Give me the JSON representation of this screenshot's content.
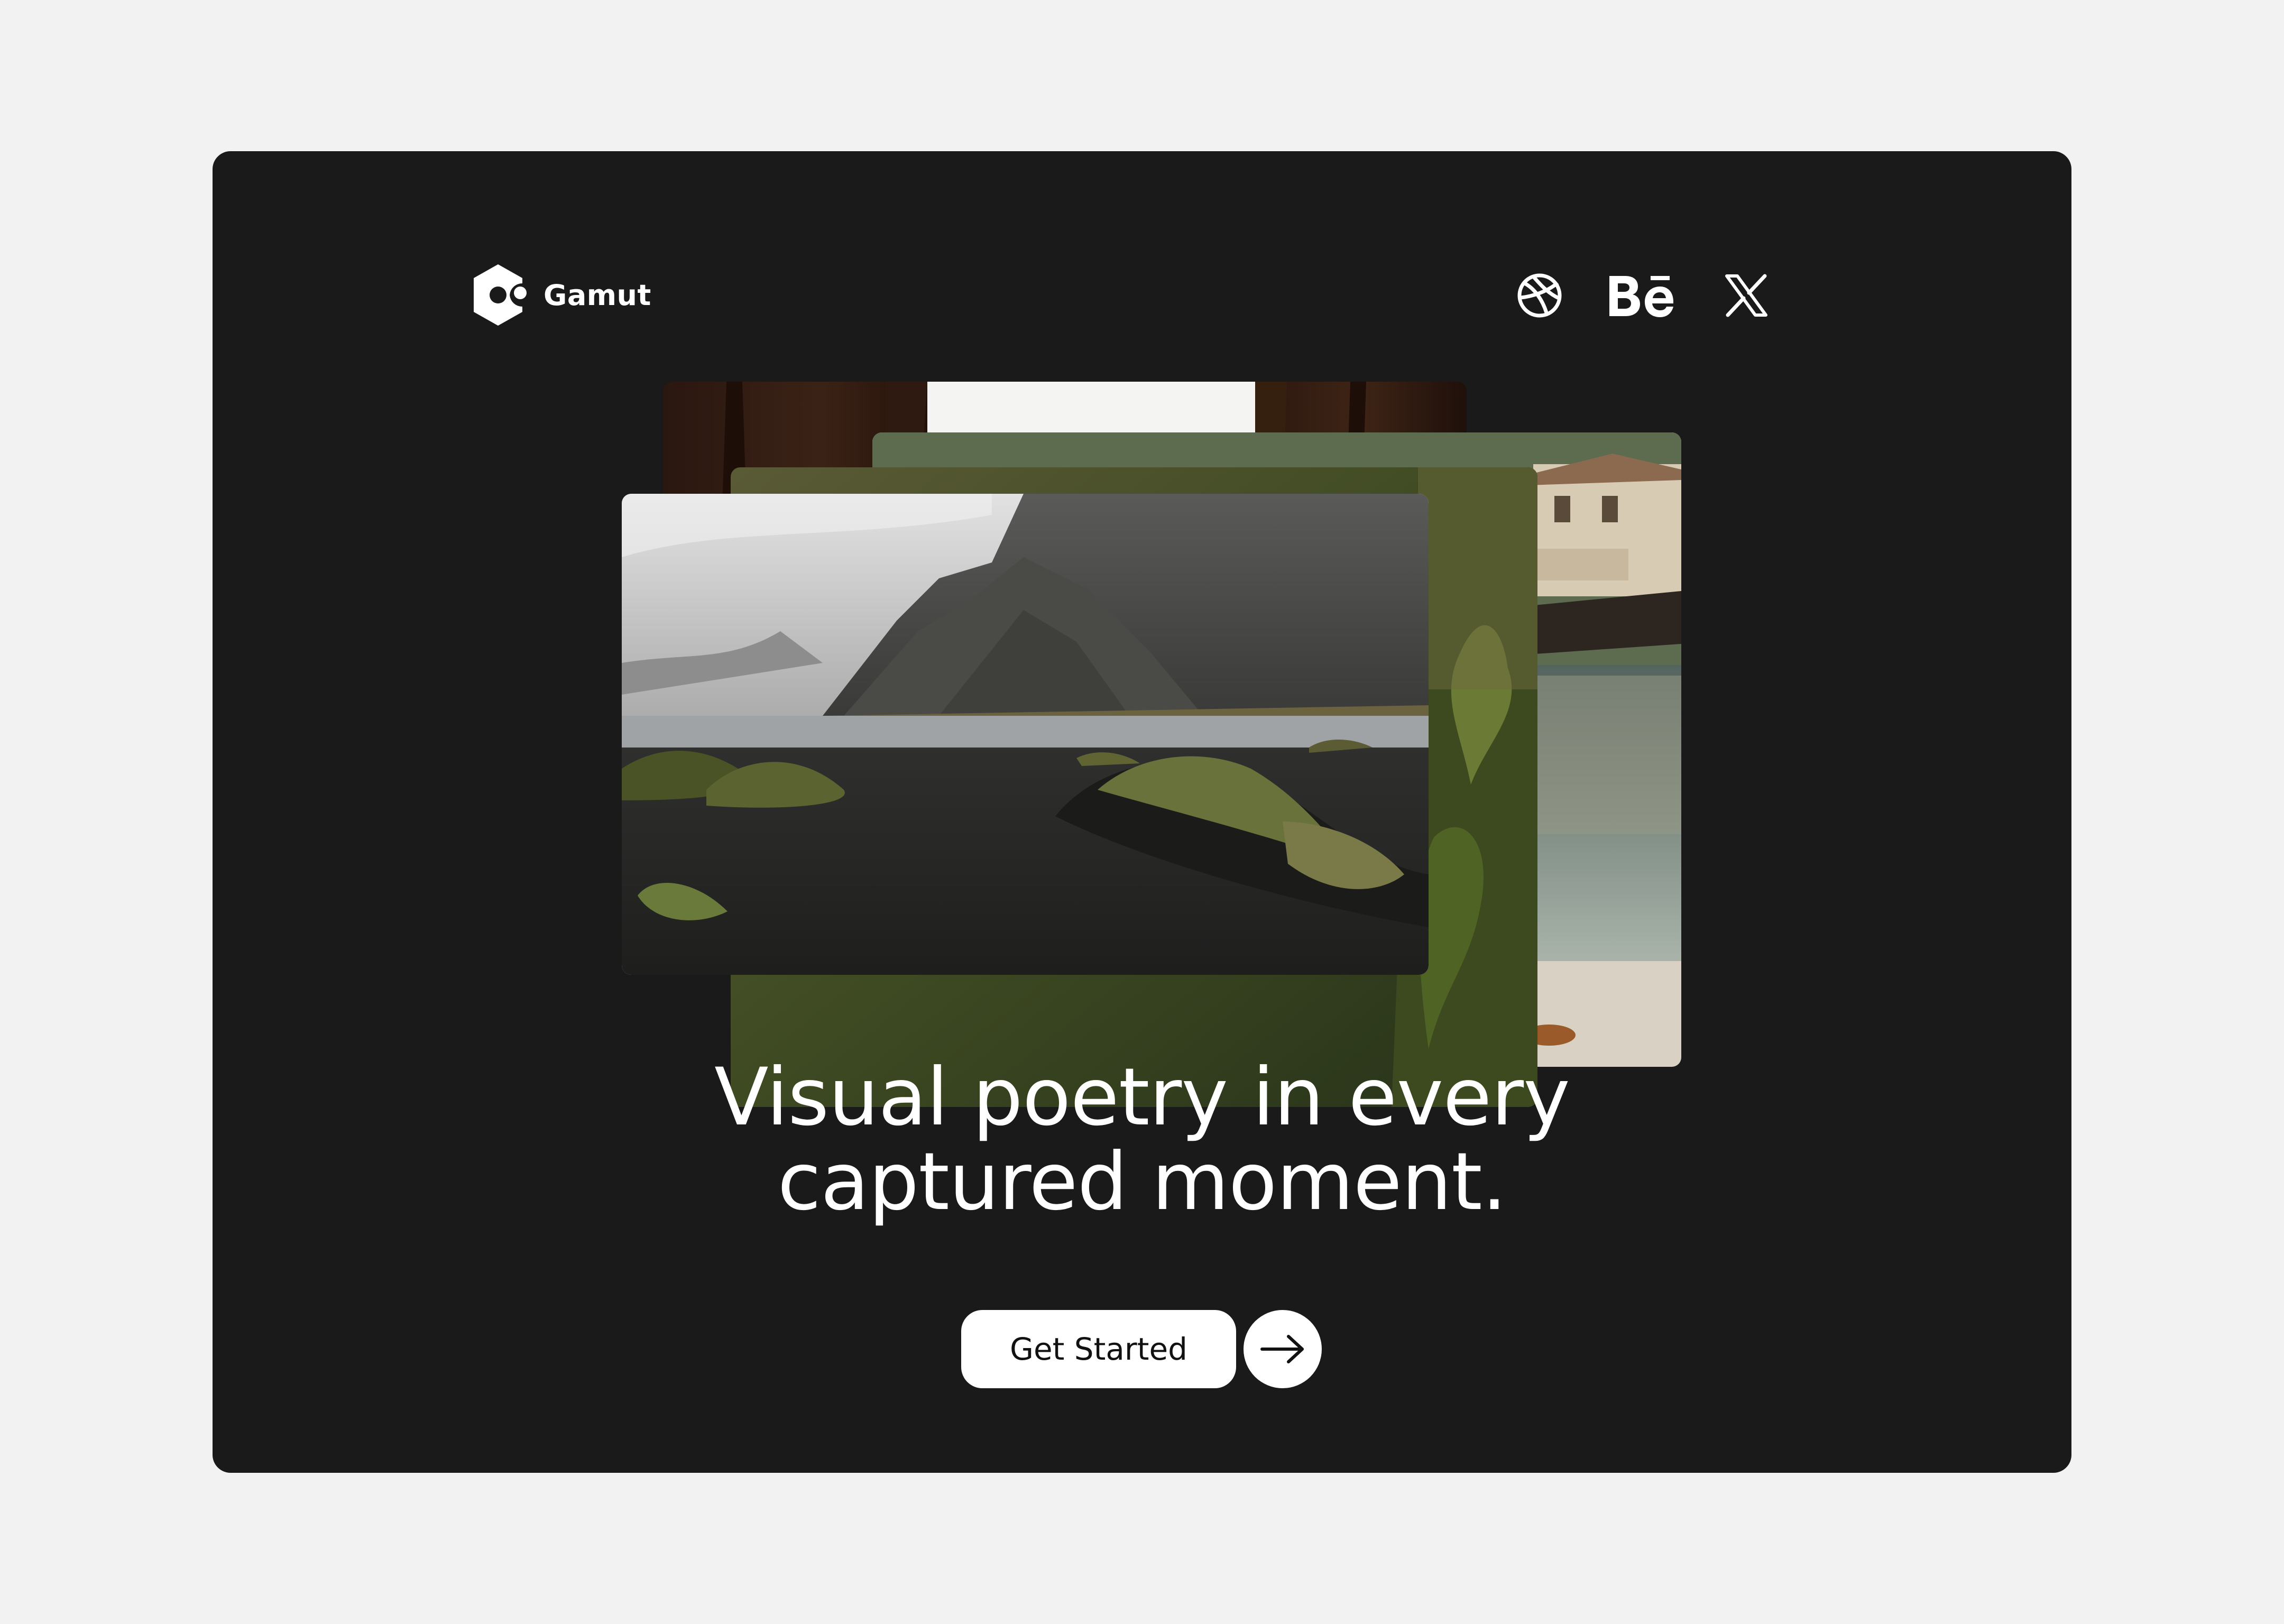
{
  "brand": {
    "name": "Gamut"
  },
  "social": {
    "dribbble_icon": "dribbble-icon",
    "behance_icon": "behance-icon",
    "x_icon": "x-icon"
  },
  "gallery": {
    "photos": [
      "interior-window-photo",
      "harbor-house-photo",
      "forest-photo",
      "black-sand-mountain-photo"
    ]
  },
  "hero": {
    "line1": "Visual poetry in every",
    "line2": "captured moment."
  },
  "cta": {
    "label": "Get Started",
    "arrow_icon": "arrow-right-icon"
  },
  "colors": {
    "page_bg": "#f2f2f2",
    "card_bg": "#1a1a1a",
    "text": "#ffffff",
    "button_bg": "#ffffff",
    "button_text": "#111111"
  }
}
